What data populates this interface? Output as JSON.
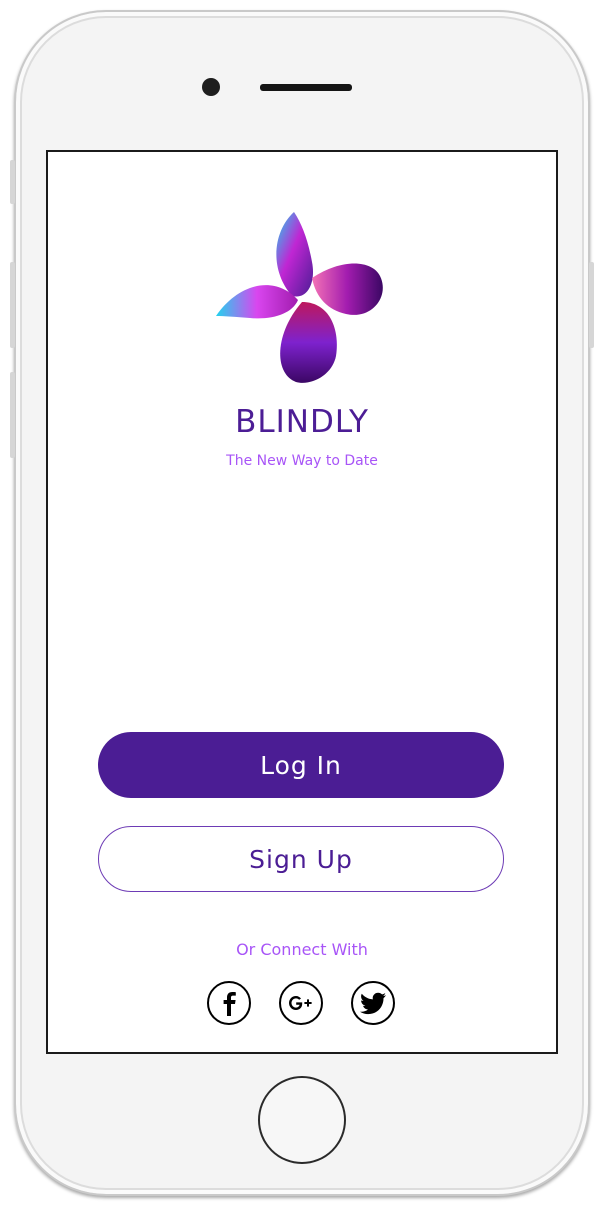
{
  "app": {
    "name": "BLINDLY",
    "tagline": "The New Way to Date"
  },
  "auth": {
    "login_label": "Log In",
    "signup_label": "Sign Up"
  },
  "social": {
    "heading": "Or Connect With",
    "providers": [
      {
        "id": "facebook",
        "icon": "facebook-icon"
      },
      {
        "id": "google-plus",
        "icon": "google-plus-icon"
      },
      {
        "id": "twitter",
        "icon": "twitter-icon"
      }
    ]
  },
  "colors": {
    "primary": "#4b1d94",
    "accent": "#a855f7",
    "brand_text": "#4c1d95"
  }
}
